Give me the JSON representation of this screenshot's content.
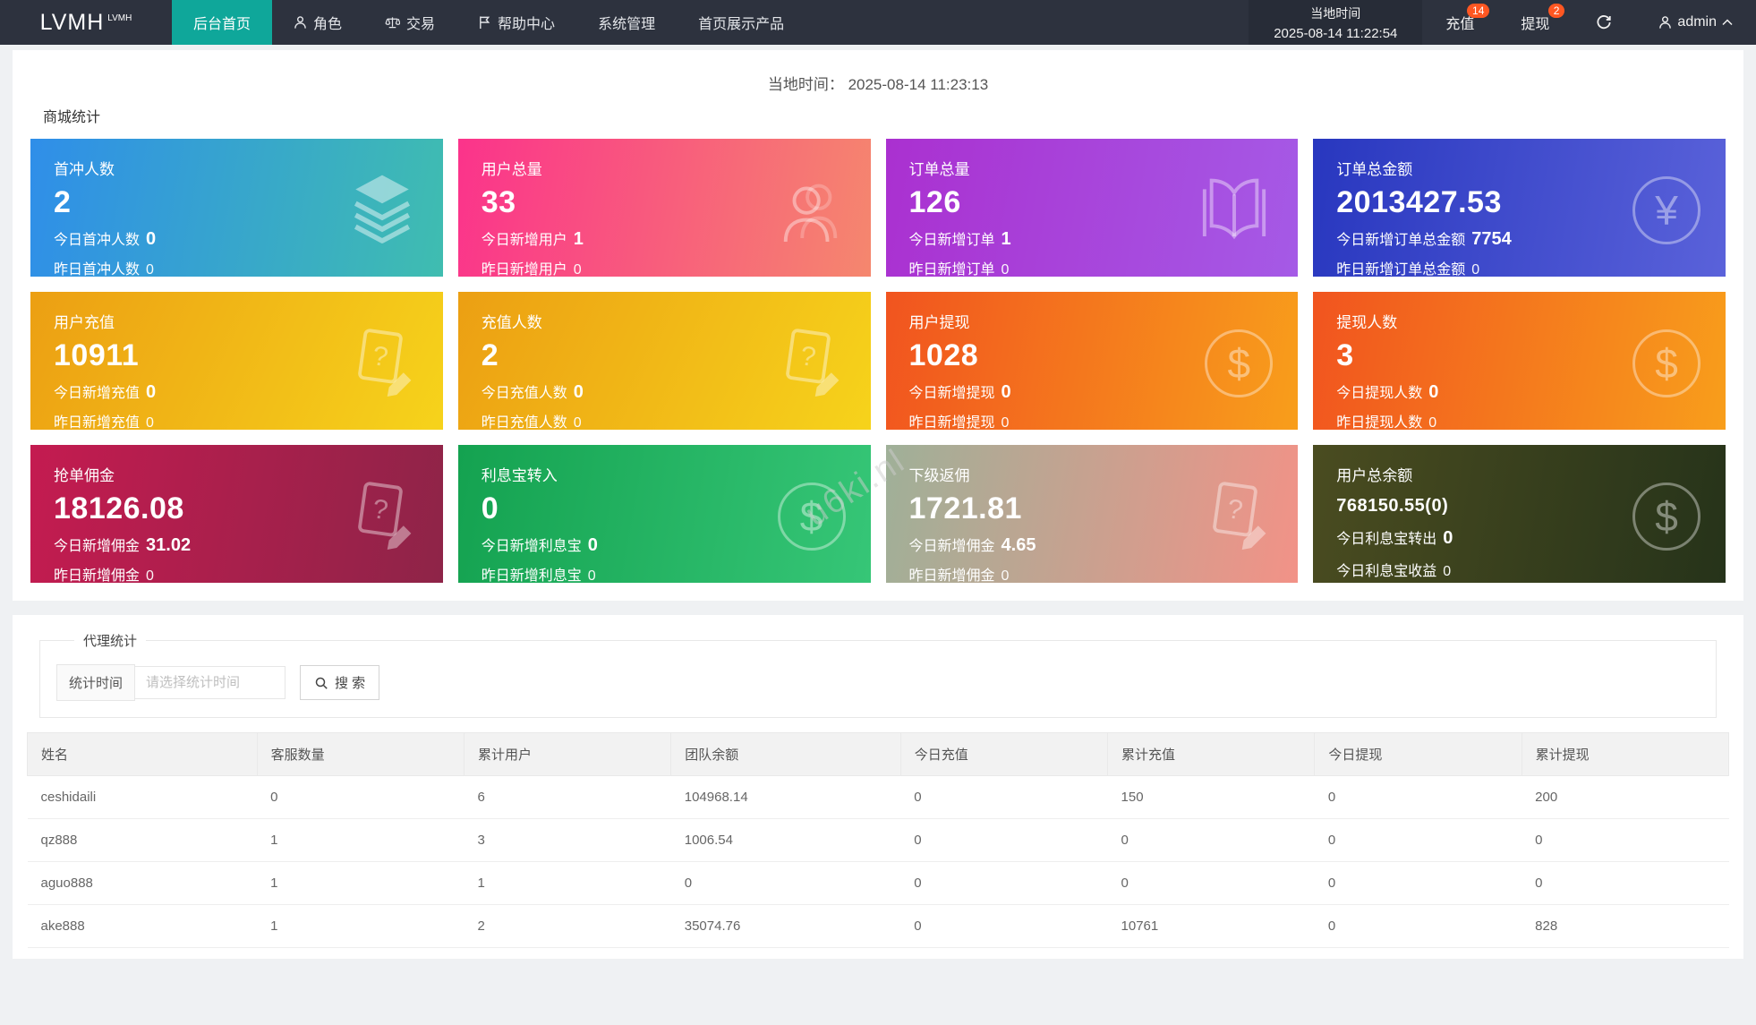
{
  "colors": {
    "accent": "#0fa79a",
    "badge": "#ff5722",
    "navbar_bg": "#2d323e",
    "page_bg": "#eff1f3"
  },
  "navbar": {
    "logo": "LVMH",
    "logo_sup": "LVMH",
    "menu": [
      {
        "label": "后台首页",
        "active": true
      },
      {
        "label": "角色",
        "icon": "user-icon"
      },
      {
        "label": "交易",
        "icon": "scales-icon"
      },
      {
        "label": "帮助中心",
        "icon": "flag-icon"
      },
      {
        "label": "系统管理"
      },
      {
        "label": "首页展示产品"
      }
    ],
    "local_time_label": "当地时间",
    "local_time_value": "2025-08-14 11:22:54",
    "recharge_label": "充值",
    "recharge_badge": "14",
    "withdraw_label": "提现",
    "withdraw_badge": "2",
    "refresh_icon": "refresh-icon",
    "user_icon": "user-icon",
    "username": "admin"
  },
  "main": {
    "clock_label": "当地时间：",
    "clock_value": "2025-08-14 11:23:13",
    "stats_title": "商城统计",
    "watermark": "u6ki.nl"
  },
  "stats": {
    "cards": [
      {
        "title": "首冲人数",
        "value": "2",
        "line1_label": "今日首冲人数",
        "line1_value": "0",
        "line2_label": "昨日首冲人数",
        "line2_value": "0",
        "icon": "layers-icon",
        "gradient": {
          "angle": "100deg",
          "from": "#2f8ee9",
          "to": "#3fbdb0"
        }
      },
      {
        "title": "用户总量",
        "value": "33",
        "line1_label": "今日新增用户",
        "line1_value": "1",
        "line2_label": "昨日新增用户",
        "line2_value": "0",
        "icon": "users-icon",
        "gradient": {
          "angle": "100deg",
          "from": "#fb338b",
          "to": "#f5876e"
        }
      },
      {
        "title": "订单总量",
        "value": "126",
        "line1_label": "今日新增订单",
        "line1_value": "1",
        "line2_label": "昨日新增订单",
        "line2_value": "0",
        "icon": "book-icon",
        "gradient": {
          "angle": "100deg",
          "from": "#aa30d0",
          "to": "#a55ae6"
        }
      },
      {
        "title": "订单总金额",
        "value": "2013427.53",
        "line1_label": "今日新增订单总金额",
        "line1_value": "7754",
        "line2_label": "昨日新增订单总金额",
        "line2_value": "0",
        "icon": "yen-circle-icon",
        "gradient": {
          "angle": "100deg",
          "from": "#2837bf",
          "to": "#5a62da"
        }
      },
      {
        "title": "用户充值",
        "value": "10911",
        "line1_label": "今日新增充值",
        "line1_value": "0",
        "line2_label": "昨日新增充值",
        "line2_value": "0",
        "icon": "doc-edit-icon",
        "gradient": {
          "angle": "115deg",
          "from": "#ec9f13",
          "to": "#f6d31b"
        }
      },
      {
        "title": "充值人数",
        "value": "2",
        "line1_label": "今日充值人数",
        "line1_value": "0",
        "line2_label": "昨日充值人数",
        "line2_value": "0",
        "icon": "doc-edit-icon",
        "gradient": {
          "angle": "115deg",
          "from": "#ec9f13",
          "to": "#f6d31b"
        }
      },
      {
        "title": "用户提现",
        "value": "1028",
        "line1_label": "今日新增提现",
        "line1_value": "0",
        "line2_label": "昨日新增提现",
        "line2_value": "0",
        "icon": "dollar-circle-icon",
        "gradient": {
          "angle": "100deg",
          "from": "#f1541f",
          "to": "#f89e1b"
        }
      },
      {
        "title": "提现人数",
        "value": "3",
        "line1_label": "今日提现人数",
        "line1_value": "0",
        "line2_label": "昨日提现人数",
        "line2_value": "0",
        "icon": "dollar-circle-icon",
        "gradient": {
          "angle": "100deg",
          "from": "#f1541f",
          "to": "#f89e1b"
        }
      },
      {
        "title": "抢单佣金",
        "value": "18126.08",
        "line1_label": "今日新增佣金",
        "line1_value": "31.02",
        "line2_label": "昨日新增佣金",
        "line2_value": "0",
        "icon": "doc-edit-icon",
        "gradient": {
          "angle": "100deg",
          "from": "#c41b50",
          "to": "#8e2448"
        }
      },
      {
        "title": "利息宝转入",
        "value": "0",
        "line1_label": "今日新增利息宝",
        "line1_value": "0",
        "line2_label": "昨日新增利息宝",
        "line2_value": "0",
        "icon": "dollar-circle-icon",
        "gradient": {
          "angle": "100deg",
          "from": "#14a250",
          "to": "#36c677"
        }
      },
      {
        "title": "下级返佣",
        "value": "1721.81",
        "line1_label": "今日新增佣金",
        "line1_value": "4.65",
        "line2_label": "昨日新增佣金",
        "line2_value": "0",
        "icon": "doc-edit-icon",
        "gradient": {
          "angle": "100deg",
          "from": "#9fb098",
          "to": "#f29287"
        }
      },
      {
        "title": "用户总余额",
        "value": "768150.55(0)",
        "line1_label": "今日利息宝转出",
        "line1_value": "0",
        "line2_label": "今日利息宝收益",
        "line2_value": "0",
        "icon": "dollar-circle-icon",
        "gradient": {
          "angle": "100deg",
          "from": "#4a4c20",
          "to": "#26331a"
        }
      }
    ]
  },
  "agent": {
    "title": "代理统计",
    "filter_label": "统计时间",
    "filter_placeholder": "请选择统计时间",
    "search_label": "搜 索",
    "search_icon": "search-icon"
  },
  "table": {
    "headers": [
      "姓名",
      "客服数量",
      "累计用户",
      "团队余额",
      "今日充值",
      "累计充值",
      "今日提现",
      "累计提现"
    ],
    "rows": [
      [
        "ceshidaili",
        "0",
        "6",
        "104968.14",
        "0",
        "150",
        "0",
        "200"
      ],
      [
        "qz888",
        "1",
        "3",
        "1006.54",
        "0",
        "0",
        "0",
        "0"
      ],
      [
        "aguo888",
        "1",
        "1",
        "0",
        "0",
        "0",
        "0",
        "0"
      ],
      [
        "ake888",
        "1",
        "2",
        "35074.76",
        "0",
        "10761",
        "0",
        "828"
      ]
    ]
  }
}
